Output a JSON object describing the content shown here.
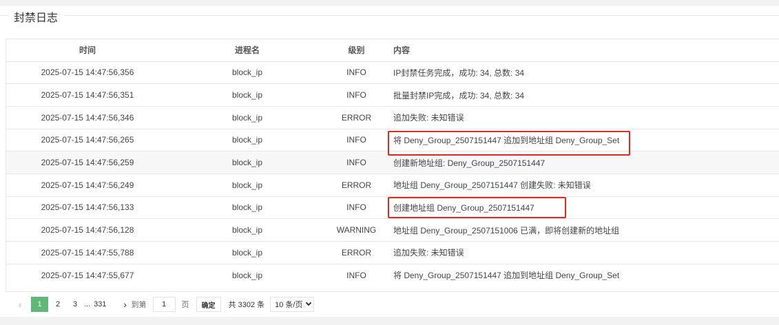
{
  "panel": {
    "title": "封禁日志"
  },
  "table": {
    "headers": {
      "time": "时间",
      "process": "进程名",
      "level": "级别",
      "content": "内容"
    },
    "rows": [
      {
        "time": "2025-07-15 14:47:56,356",
        "process": "block_ip",
        "level": "INFO",
        "content": "IP封禁任务完成，成功: 34, 总数: 34"
      },
      {
        "time": "2025-07-15 14:47:56,351",
        "process": "block_ip",
        "level": "INFO",
        "content": "批量封禁IP完成，成功: 34, 总数: 34"
      },
      {
        "time": "2025-07-15 14:47:56,346",
        "process": "block_ip",
        "level": "ERROR",
        "content": "追加失败: 未知错误"
      },
      {
        "time": "2025-07-15 14:47:56,265",
        "process": "block_ip",
        "level": "INFO",
        "content": "将 Deny_Group_2507151447 追加到地址组 Deny_Group_Set"
      },
      {
        "time": "2025-07-15 14:47:56,259",
        "process": "block_ip",
        "level": "INFO",
        "content": "创建新地址组: Deny_Group_2507151447"
      },
      {
        "time": "2025-07-15 14:47:56,249",
        "process": "block_ip",
        "level": "ERROR",
        "content": "地址组 Deny_Group_2507151447 创建失败: 未知错误"
      },
      {
        "time": "2025-07-15 14:47:56,133",
        "process": "block_ip",
        "level": "INFO",
        "content": "创建地址组 Deny_Group_2507151447"
      },
      {
        "time": "2025-07-15 14:47:56,128",
        "process": "block_ip",
        "level": "WARNING",
        "content": "地址组 Deny_Group_2507151006 已满，即将创建新的地址组"
      },
      {
        "time": "2025-07-15 14:47:55,788",
        "process": "block_ip",
        "level": "ERROR",
        "content": "追加失败: 未知错误"
      },
      {
        "time": "2025-07-15 14:47:55,677",
        "process": "block_ip",
        "level": "INFO",
        "content": "将 Deny_Group_2507151447 追加到地址组 Deny_Group_Set"
      }
    ]
  },
  "pager": {
    "pages": [
      "1",
      "2",
      "3"
    ],
    "ellipsis": "...",
    "last_page": "331",
    "goto_prefix": "到第",
    "goto_value": "1",
    "goto_suffix": "页",
    "confirm": "确定",
    "total": "共 3302 条",
    "page_size": "10 条/页",
    "prev_icon": "chevron-left-icon",
    "next_icon": "chevron-right-icon",
    "active_color": "#5fb878"
  },
  "annotation_color": "#e0281f"
}
